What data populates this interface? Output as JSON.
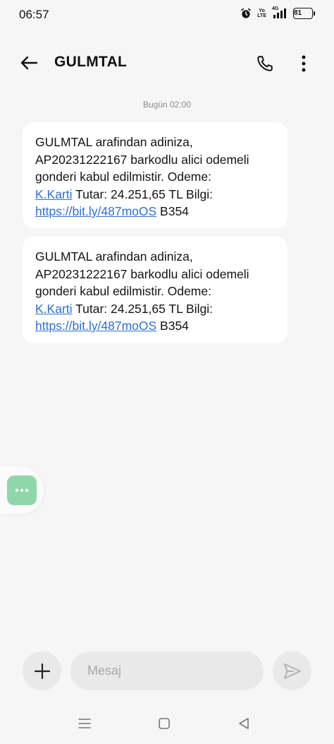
{
  "status_bar": {
    "time": "06:57",
    "network_label_top": "Yo",
    "network_label_bottom": "LTE",
    "signal_label": "4G",
    "battery": "81",
    "icons": [
      "alarm-icon",
      "volte-icon",
      "signal-icon",
      "battery-icon"
    ]
  },
  "header": {
    "title": "GULMTAL",
    "back_icon": "arrow-left-icon",
    "call_icon": "phone-icon",
    "more_icon": "more-vertical-icon"
  },
  "conversation": {
    "date_label": "Bugün 02:00",
    "messages": [
      {
        "line1": "GULMTAL arafindan adiniza,",
        "line2": "AP20231222167 barkodlu alici odemeli",
        "line3": "gonderi kabul edilmistir. Odeme:",
        "link1": "K.Karti",
        "line4_rest": " Tutar: 24.251,65 TL Bilgi:",
        "link2": "https://bit.ly/487moOS",
        "line5_rest": " B354"
      },
      {
        "line1": "GULMTAL arafindan adiniza,",
        "line2": "AP20231222167 barkodlu alici odemeli",
        "line3": "gonderi kabul edilmistir. Odeme:",
        "link1": "K.Karti",
        "line4_rest": " Tutar: 24.251,65 TL Bilgi:",
        "link2": "https://bit.ly/487moOS",
        "line5_rest": " B354"
      }
    ]
  },
  "quick_action": {
    "icon": "chat-dots-icon",
    "color": "#8fd7a8"
  },
  "composer": {
    "placeholder": "Mesaj",
    "add_icon": "plus-icon",
    "send_icon": "send-icon"
  },
  "navigation": {
    "icons": [
      "menu-icon",
      "home-icon",
      "back-triangle-icon"
    ]
  },
  "colors": {
    "background": "#f6f6f6",
    "bubble": "#ffffff",
    "link": "#2f6fd6",
    "accent_green": "#8fd7a8"
  }
}
